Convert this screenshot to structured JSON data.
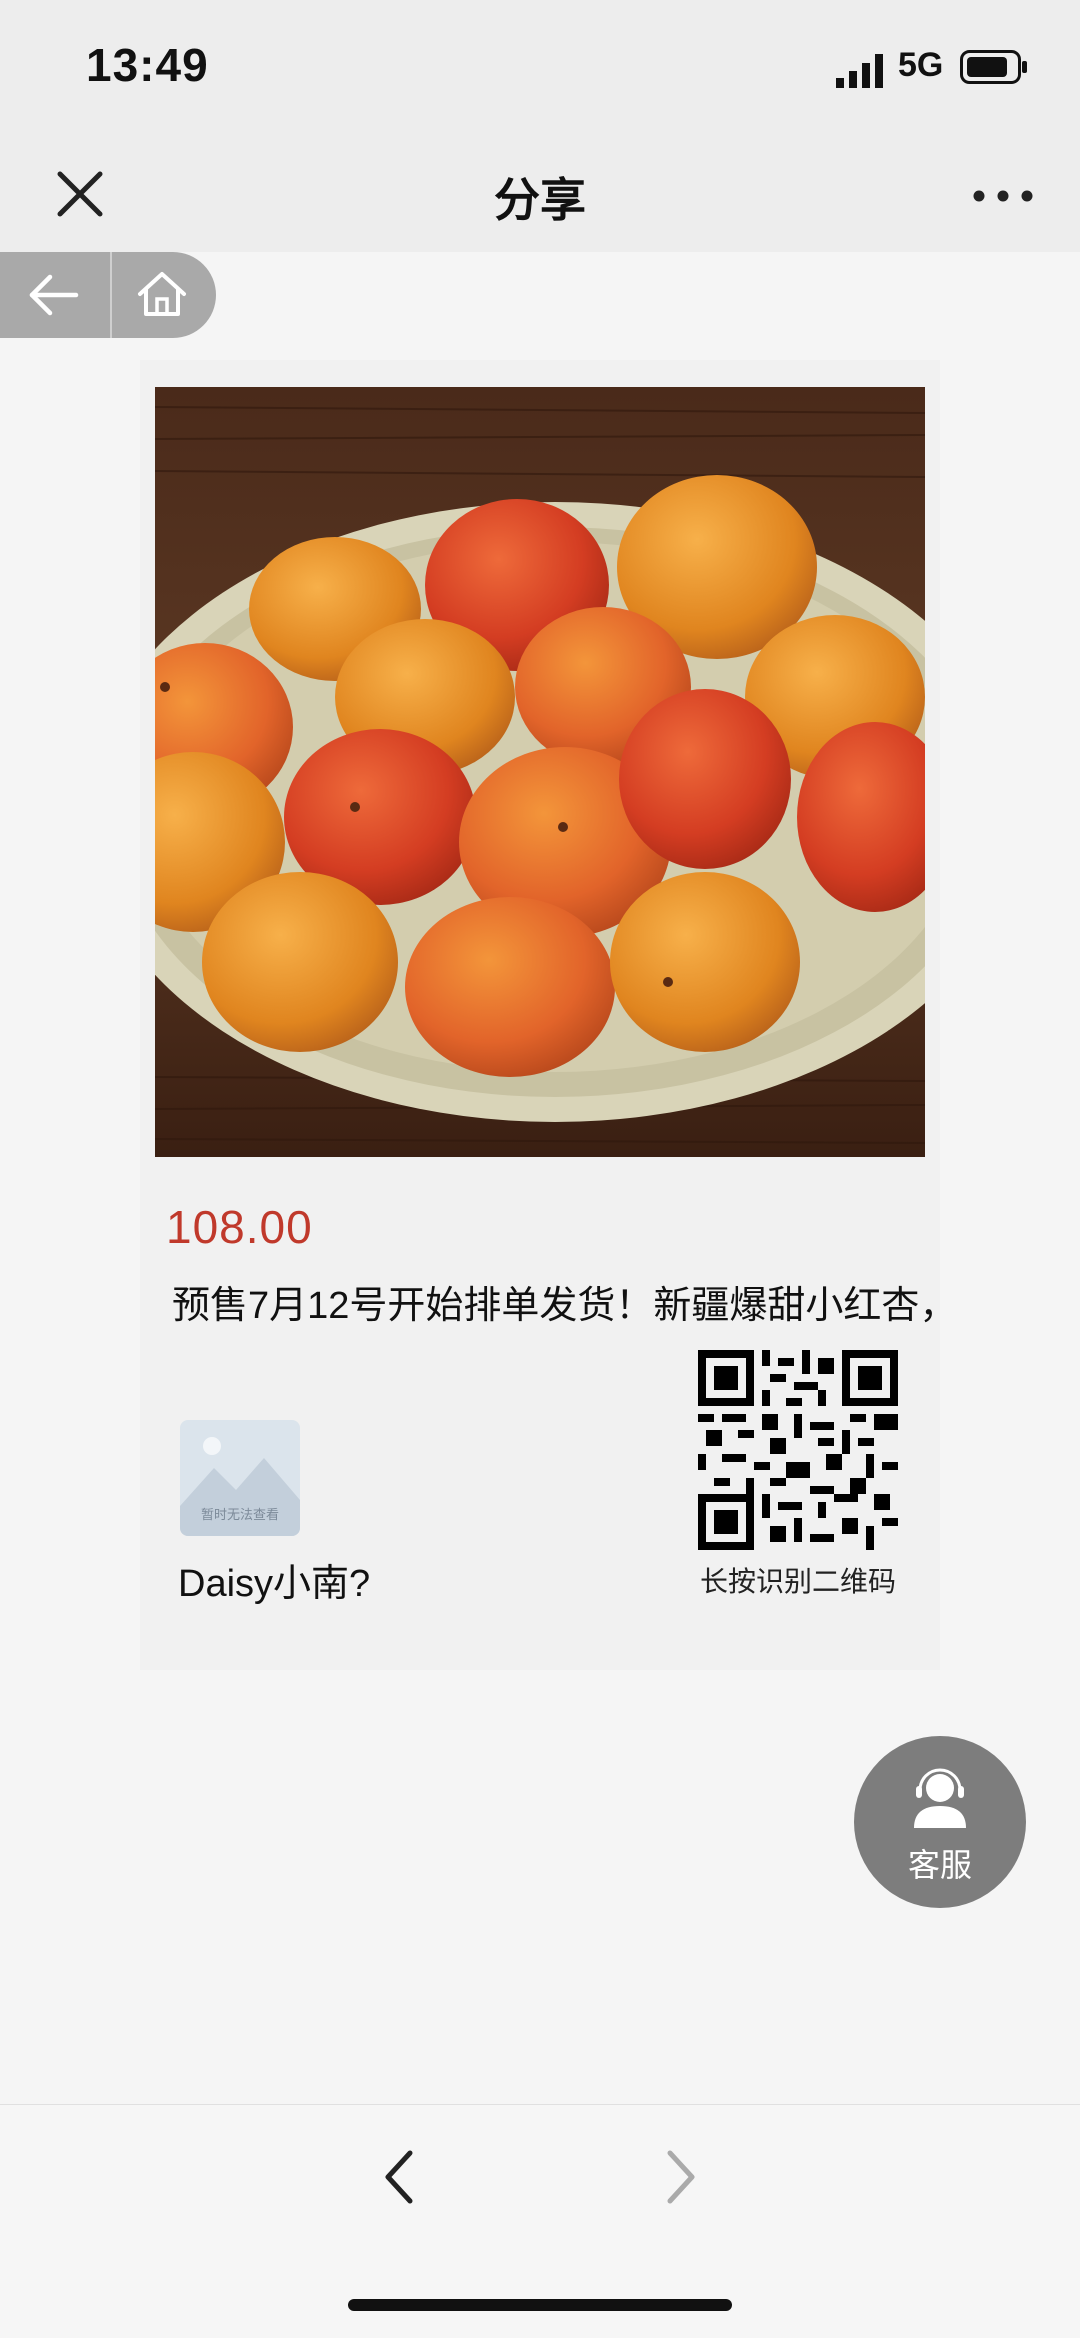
{
  "status_bar": {
    "time": "13:49",
    "network": "5G"
  },
  "nav": {
    "title": "分享"
  },
  "product": {
    "price": "108.00",
    "description": "预售7月12号开始排单发货！新疆爆甜小红杏，",
    "image_icon": "apricots-plate-photo"
  },
  "seller": {
    "name": "Daisy小南?",
    "avatar_placeholder": "暂时无法查看"
  },
  "qr": {
    "caption": "长按识别二维码"
  },
  "service": {
    "label": "客服"
  },
  "colors": {
    "price": "#c0392b",
    "service_button": "#7d7d7d",
    "status_bar_bg": "#ededed"
  }
}
